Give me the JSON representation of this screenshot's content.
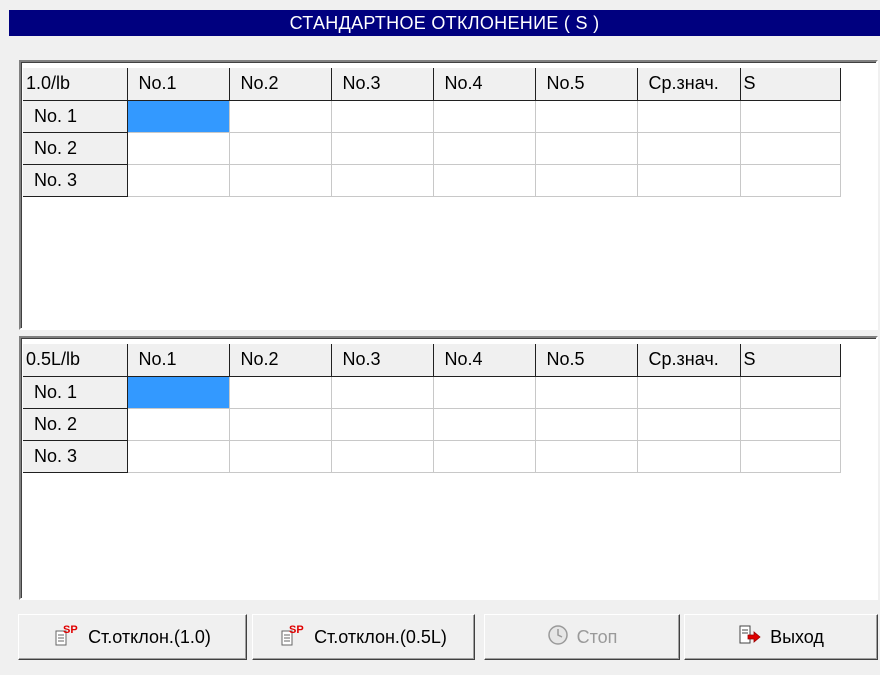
{
  "window": {
    "title": "СТАНДАРТНОЕ ОТКЛОНЕНИЕ ( S )"
  },
  "table1": {
    "headers": [
      "1.0/lb",
      "No.1",
      "No.2",
      "No.3",
      "No.4",
      "No.5",
      "Ср.знач.",
      "S"
    ],
    "rows": [
      {
        "label": "No. 1",
        "cells": [
          "",
          "",
          "",
          "",
          "",
          "",
          ""
        ]
      },
      {
        "label": "No. 2",
        "cells": [
          "",
          "",
          "",
          "",
          "",
          "",
          ""
        ]
      },
      {
        "label": "No. 3",
        "cells": [
          "",
          "",
          "",
          "",
          "",
          "",
          ""
        ]
      }
    ]
  },
  "table2": {
    "headers": [
      "0.5L/lb",
      "No.1",
      "No.2",
      "No.3",
      "No.4",
      "No.5",
      "Ср.знач.",
      "S"
    ],
    "rows": [
      {
        "label": "No. 1",
        "cells": [
          "",
          "",
          "",
          "",
          "",
          "",
          ""
        ]
      },
      {
        "label": "No. 2",
        "cells": [
          "",
          "",
          "",
          "",
          "",
          "",
          ""
        ]
      },
      {
        "label": "No. 3",
        "cells": [
          "",
          "",
          "",
          "",
          "",
          "",
          ""
        ]
      }
    ]
  },
  "buttons": {
    "std10": {
      "label": "Ст.отклон.(1.0)",
      "icon": "sp-calc-icon"
    },
    "std05": {
      "label": "Ст.отклон.(0.5L)",
      "icon": "sp-calc-icon"
    },
    "stop": {
      "label": "Стоп",
      "icon": "stop-clock-icon",
      "disabled": true
    },
    "exit": {
      "label": "Выход",
      "icon": "exit-door-icon"
    }
  },
  "colors": {
    "title_bg": "#00007f",
    "selection": "#3399ff",
    "sp_icon_red": "#e00000"
  }
}
